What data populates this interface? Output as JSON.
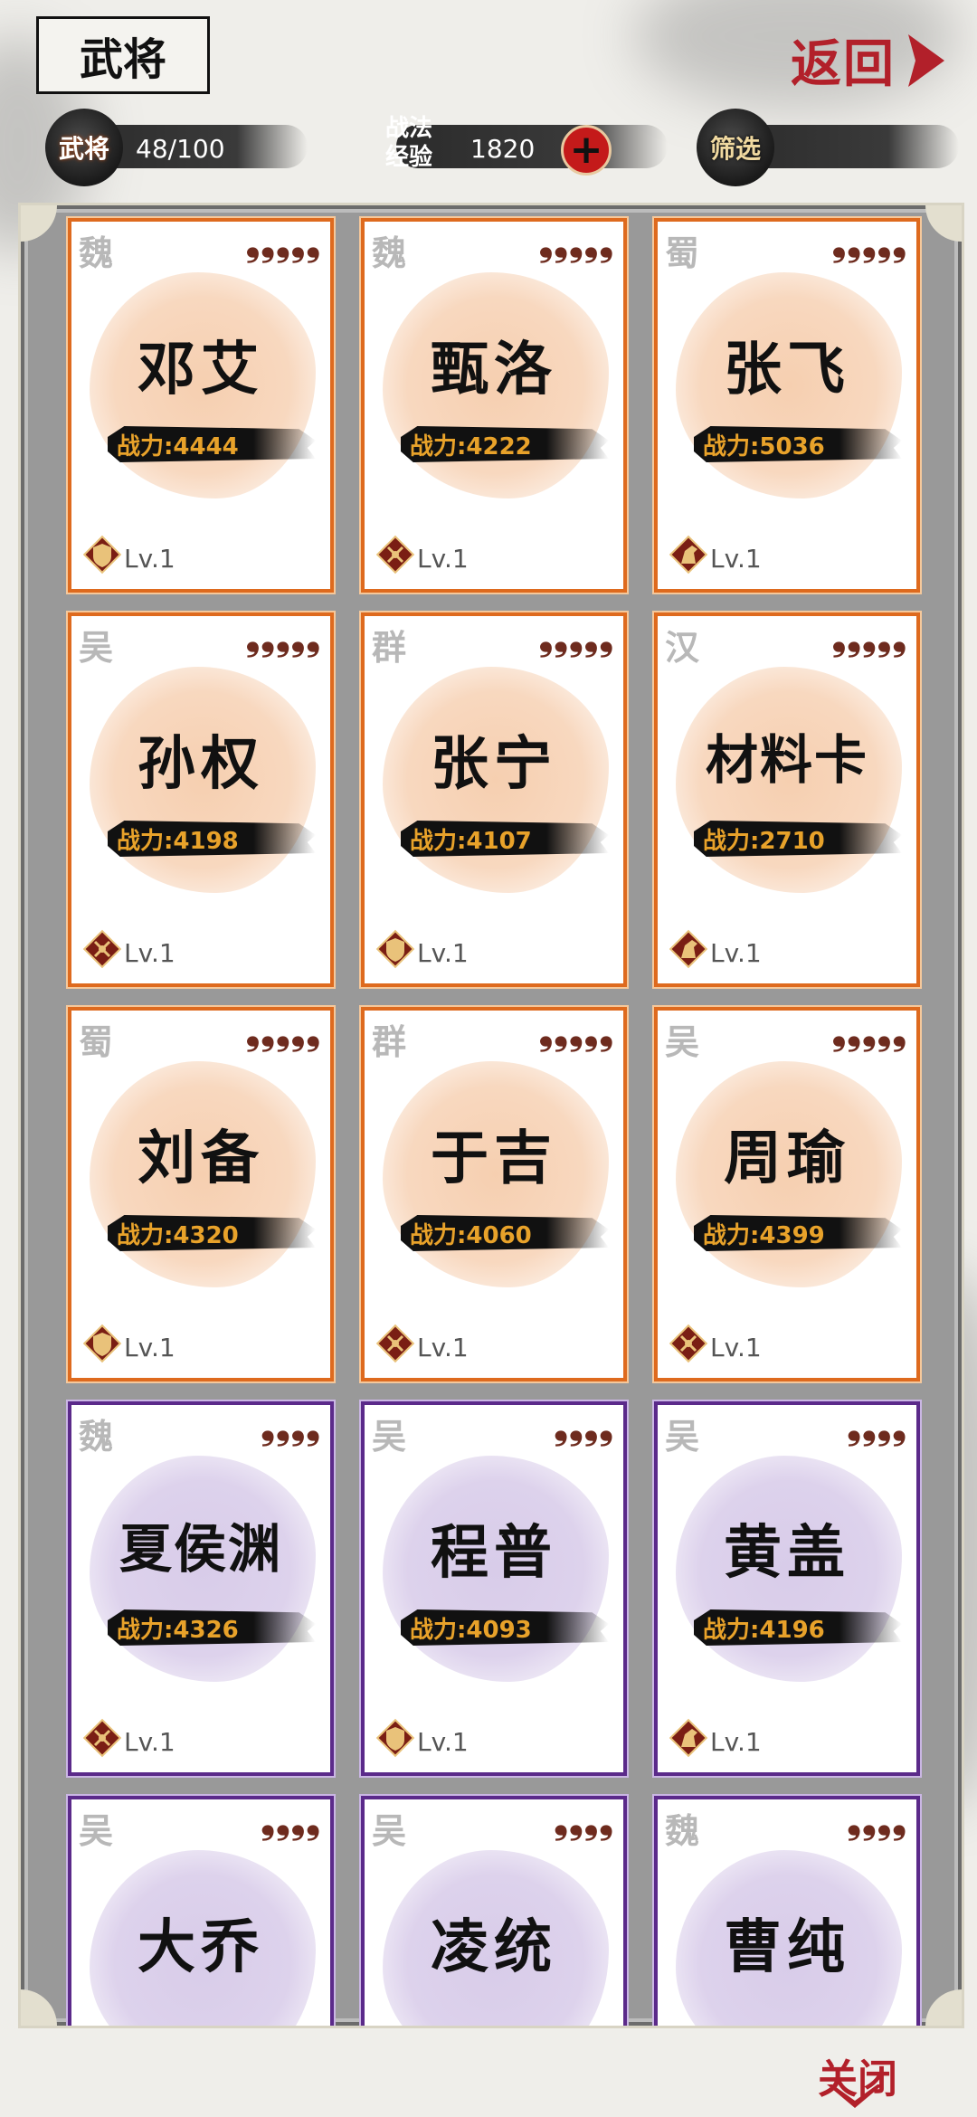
{
  "header": {
    "title": "武将",
    "back_label": "返回"
  },
  "stats": {
    "heroes_label": "武将",
    "heroes_count": "48/100",
    "exp_label_line1": "战法",
    "exp_label_line2": "经验",
    "exp_value": "1820",
    "filter_label": "筛选"
  },
  "cards": [
    {
      "faction": "魏",
      "stars": "❟❟❟❟❟",
      "name": "邓艾",
      "power": "战力:4444",
      "level": "Lv.1",
      "icon": "shield-icon",
      "rarity": "orange"
    },
    {
      "faction": "魏",
      "stars": "❟❟❟❟❟",
      "name": "甄洛",
      "power": "战力:4222",
      "level": "Lv.1",
      "icon": "bow-icon",
      "rarity": "orange"
    },
    {
      "faction": "蜀",
      "stars": "❟❟❟❟❟",
      "name": "张飞",
      "power": "战力:5036",
      "level": "Lv.1",
      "icon": "horse-icon",
      "rarity": "orange"
    },
    {
      "faction": "吴",
      "stars": "❟❟❟❟❟",
      "name": "孙权",
      "power": "战力:4198",
      "level": "Lv.1",
      "icon": "bow-icon",
      "rarity": "orange"
    },
    {
      "faction": "群",
      "stars": "❟❟❟❟❟",
      "name": "张宁",
      "power": "战力:4107",
      "level": "Lv.1",
      "icon": "shield-icon",
      "rarity": "orange"
    },
    {
      "faction": "汉",
      "stars": "❟❟❟❟❟",
      "name": "材料卡",
      "power": "战力:2710",
      "level": "Lv.1",
      "icon": "horse-icon",
      "rarity": "orange"
    },
    {
      "faction": "蜀",
      "stars": "❟❟❟❟❟",
      "name": "刘备",
      "power": "战力:4320",
      "level": "Lv.1",
      "icon": "shield-icon",
      "rarity": "orange"
    },
    {
      "faction": "群",
      "stars": "❟❟❟❟❟",
      "name": "于吉",
      "power": "战力:4060",
      "level": "Lv.1",
      "icon": "bow-icon",
      "rarity": "orange"
    },
    {
      "faction": "吴",
      "stars": "❟❟❟❟❟",
      "name": "周瑜",
      "power": "战力:4399",
      "level": "Lv.1",
      "icon": "bow-icon",
      "rarity": "orange"
    },
    {
      "faction": "魏",
      "stars": "❟❟❟❟",
      "name": "夏侯渊",
      "power": "战力:4326",
      "level": "Lv.1",
      "icon": "bow-icon",
      "rarity": "purple"
    },
    {
      "faction": "吴",
      "stars": "❟❟❟❟",
      "name": "程普",
      "power": "战力:4093",
      "level": "Lv.1",
      "icon": "shield-icon",
      "rarity": "purple"
    },
    {
      "faction": "吴",
      "stars": "❟❟❟❟",
      "name": "黄盖",
      "power": "战力:4196",
      "level": "Lv.1",
      "icon": "horse-icon",
      "rarity": "purple"
    },
    {
      "faction": "吴",
      "stars": "❟❟❟❟",
      "name": "大乔",
      "power": "",
      "level": "",
      "icon": "",
      "rarity": "purple"
    },
    {
      "faction": "吴",
      "stars": "❟❟❟❟",
      "name": "凌统",
      "power": "",
      "level": "",
      "icon": "",
      "rarity": "purple"
    },
    {
      "faction": "魏",
      "stars": "❟❟❟❟",
      "name": "曹纯",
      "power": "",
      "level": "",
      "icon": "",
      "rarity": "purple"
    }
  ],
  "footer": {
    "close_label": "关闭"
  }
}
